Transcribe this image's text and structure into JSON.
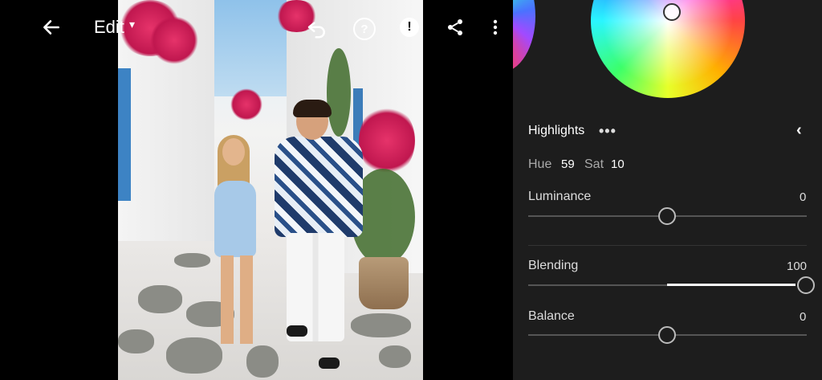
{
  "toolbar": {
    "edit_label": "Edit",
    "icons": [
      "back-arrow-icon",
      "undo-icon",
      "help-icon",
      "alert-icon",
      "share-icon",
      "more-vertical-icon"
    ]
  },
  "panel": {
    "section_title": "Highlights",
    "hue_label": "Hue",
    "hue_value": "59",
    "sat_label": "Sat",
    "sat_value": "10",
    "luminance": {
      "label": "Luminance",
      "value": "0",
      "level": 0.5
    },
    "blending": {
      "label": "Blending",
      "value": "100",
      "level": 1.0
    },
    "balance": {
      "label": "Balance",
      "value": "0",
      "level": 0.5
    }
  },
  "colors": {
    "panel_bg": "#1d1d1d",
    "track": "#555555",
    "active_track": "#ffffff"
  }
}
